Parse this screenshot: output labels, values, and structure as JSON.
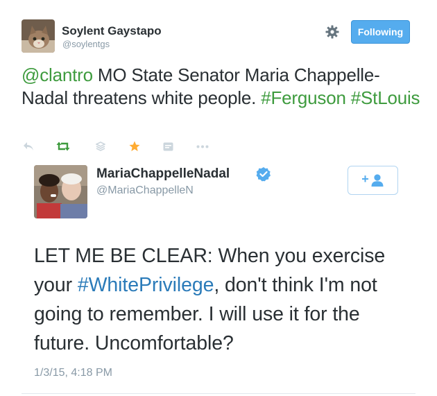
{
  "outer_tweet": {
    "display_name": "Soylent Gaystapo",
    "handle": "@soylentgs",
    "follow_label": "Following",
    "text_parts": {
      "mention": "@clantro",
      "body": " MO State Senator Maria Chappelle-Nadal threatens white people. ",
      "hashtag1": "#Ferguson",
      "space": " ",
      "hashtag2": "#StLouis"
    },
    "actions": [
      "reply-icon",
      "retweet-icon",
      "layers-icon",
      "favorite-icon",
      "image-icon",
      "more-icon"
    ]
  },
  "quoted_tweet": {
    "display_name": "MariaChappelleNadal",
    "handle": "@MariaChappelleN",
    "follow_icon": "+",
    "text_parts": {
      "before": "LET ME BE CLEAR: When you exercise your ",
      "hashtag": "#WhitePrivilege",
      "after": ", don't think I'm not going to remember. I will use it for the future. Uncomfortable?"
    },
    "timestamp": "1/3/15, 4:18 PM"
  },
  "colors": {
    "accent_green": "#3e9b3e",
    "link_blue": "#2b7bb9",
    "follow_bg": "#55acee",
    "favorite_orange": "#ffac33"
  }
}
